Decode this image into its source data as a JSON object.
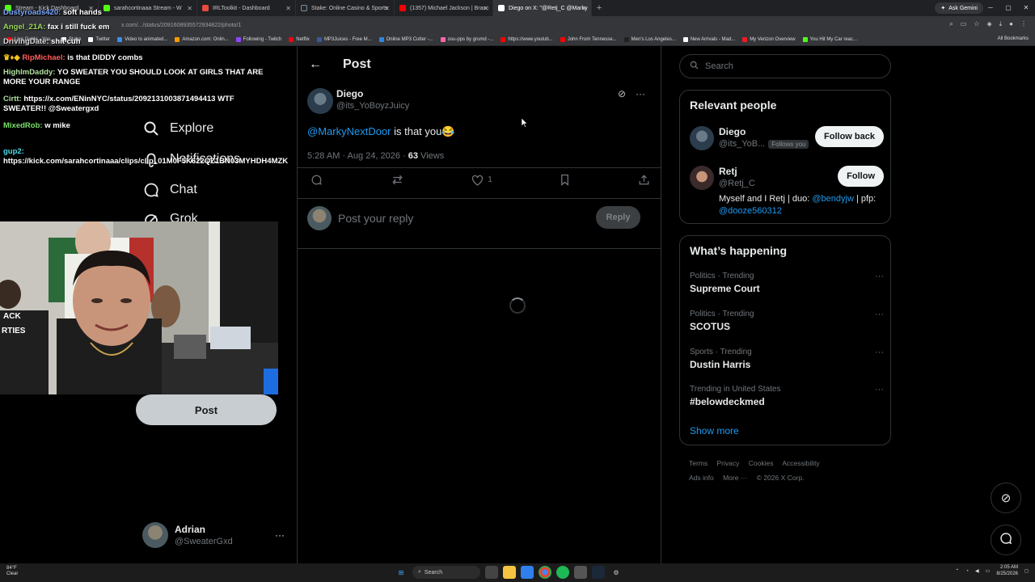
{
  "browser": {
    "tabs": [
      {
        "title": "Stream - Kick Dashboard",
        "color": "#53fc18"
      },
      {
        "title": "sarahcortinaaa Stream - W",
        "color": "#53fc18"
      },
      {
        "title": "IRLToolkit - Dashboard",
        "color": "#e94b3c"
      },
      {
        "title": "Stake: Online Casino & Sports",
        "color": "#1a2c38"
      },
      {
        "title": "(1357) Michael Jackson | Bracc",
        "color": "#ff0000"
      },
      {
        "title": "Diego on X: \"@Retj_C @Marky",
        "color": "#ffffff"
      }
    ],
    "new_tab": "+",
    "ask_gemini": "Ask Gemini",
    "url": "x.com/.../status/2091608935572934822/photo/1",
    "bookmarks": [
      {
        "label": "Live Guide - You...",
        "color": "#ff0000"
      },
      {
        "label": "Stake",
        "color": "#ffffff"
      },
      {
        "label": "Twitter",
        "color": "#ffffff"
      },
      {
        "label": "Video to animated...",
        "color": "#3b8eea"
      },
      {
        "label": "Amazon.com: Onlin...",
        "color": "#ff9900"
      },
      {
        "label": "Following - Twitch",
        "color": "#9146ff"
      },
      {
        "label": "Netflix",
        "color": "#e50914"
      },
      {
        "label": "MP3Juices - Free M...",
        "color": "#3b5998"
      },
      {
        "label": "Online MP3 Cutter -...",
        "color": "#2e86de"
      },
      {
        "label": "osu-pps by grumd -...",
        "color": "#ff66aa"
      },
      {
        "label": "https://www.youtub...",
        "color": "#ff0000"
      },
      {
        "label": "John From Tennesse...",
        "color": "#ff0000"
      },
      {
        "label": "Men's Los Angeles...",
        "color": "#222222"
      },
      {
        "label": "New Arrivals - Mad...",
        "color": "#ffffff"
      },
      {
        "label": "My Verizon Overview",
        "color": "#ee1c25"
      },
      {
        "label": "You Hit My Car reac...",
        "color": "#53fc18"
      }
    ],
    "all_bookmarks": "All Bookmarks"
  },
  "chat": [
    {
      "user": "Dustyroads420:",
      "msg": "soft hands",
      "cls": "u1"
    },
    {
      "user": "Angel_21A:",
      "msg": "fax i still fuck em",
      "cls": "u2"
    },
    {
      "user": "DrivingDate:",
      "msg": "shit cuh",
      "cls": "u7"
    },
    {
      "user": "RipMichael:",
      "msg": "is that DIDDY combs",
      "cls": "u3"
    },
    {
      "user": "HighlmDaddy:",
      "msg": "YO SWEATER YOU SHOULD LOOK AT GIRLS THAT ARE MORE YOUR RANGE",
      "cls": "u4"
    },
    {
      "user": "Cirtt:",
      "msg": "https://x.com/ENinNYC/status/2092131003871494413 WTF SWEATER!! @Sweatergxd",
      "cls": "u4"
    },
    {
      "user": "MixedRob:",
      "msg": "w mike",
      "cls": "u5"
    },
    {
      "user": "gup2:",
      "msg": "https://kick.com/sarahcortinaaa/clips/clip_01M0F5K622QZ1BN03MYHDH4MZK",
      "cls": "u6"
    }
  ],
  "nav": {
    "explore": "Explore",
    "notifications": "Notifications",
    "chat": "Chat",
    "grok": "Grok",
    "post_button": "Post"
  },
  "account": {
    "display_name": "Adrian",
    "handle": "@SweaterGxd",
    "more": "···"
  },
  "post": {
    "header": "Post",
    "author_name": "Diego",
    "author_handle": "@its_YoBoyzJuicy",
    "mention": "@MarkyNextDoor",
    "text": " is that you😂",
    "time": "5:28 AM · Aug 24, 2026 · ",
    "views_count": "63",
    "views_label": " Views",
    "like_count": "1",
    "reply_placeholder": "Post your reply",
    "reply_button": "Reply"
  },
  "sidebar": {
    "search_placeholder": "Search",
    "relevant_title": "Relevant people",
    "people": [
      {
        "name": "Diego",
        "handle": "@its_YoB...",
        "badge": "Follows you",
        "button": "Follow back",
        "bio": ""
      },
      {
        "name": "Retj",
        "handle": "@Retj_C",
        "badge": "",
        "button": "Follow",
        "bio_prefix": "Myself and I Retj | duo: ",
        "bio_link1": "@bendyjw",
        "bio_mid": " | pfp: ",
        "bio_link2": "@dooze560312"
      }
    ],
    "happening_title": "What’s happening",
    "trends": [
      {
        "context": "Politics · Trending",
        "name": "Supreme Court"
      },
      {
        "context": "Politics · Trending",
        "name": "SCOTUS"
      },
      {
        "context": "Sports · Trending",
        "name": "Dustin Harris"
      },
      {
        "context": "Trending in United States",
        "name": "#belowdeckmed"
      }
    ],
    "show_more": "Show more",
    "footer": [
      "Terms",
      "Privacy",
      "Cookies",
      "Accessibility",
      "Ads info",
      "More ···",
      "© 2026 X Corp."
    ]
  },
  "taskbar": {
    "weather_temp": "84°F",
    "weather_desc": "Clear",
    "search": "Search",
    "time": "2:05 AM",
    "date": "8/25/2026"
  }
}
